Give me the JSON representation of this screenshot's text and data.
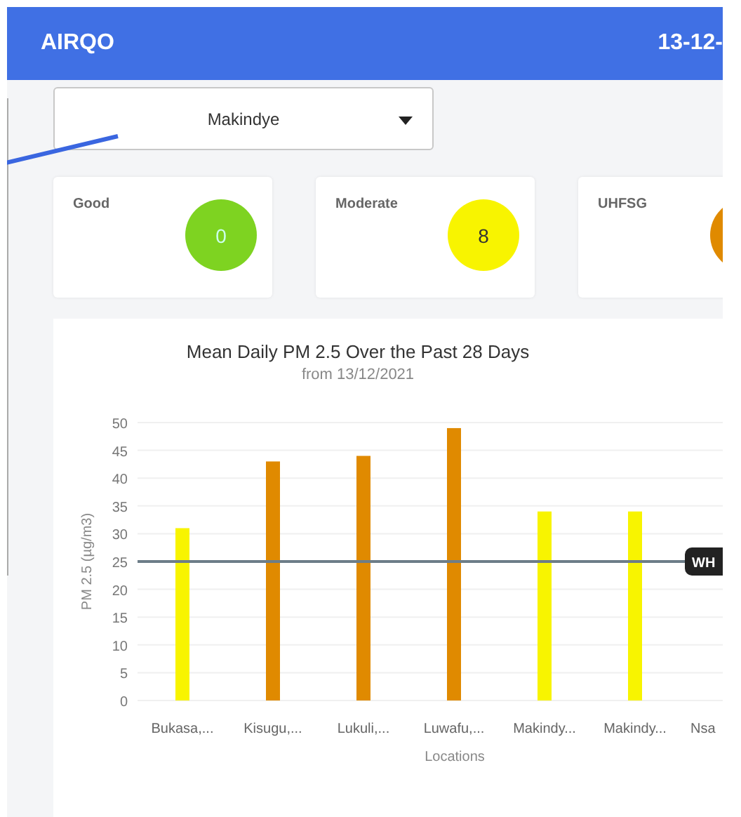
{
  "header": {
    "logo": "AIRQO",
    "date": "13-12-"
  },
  "location_select": {
    "value": "Makindye"
  },
  "category_cards": [
    {
      "label": "Good",
      "count": "0",
      "color": "#7ed321"
    },
    {
      "label": "Moderate",
      "count": "8",
      "color": "#f8f400"
    },
    {
      "label": "UHFSG",
      "color": "#e08a00"
    }
  ],
  "chart": {
    "title": "Mean Daily PM 2.5 Over the Past 28 Days",
    "subtitle": "from 13/12/2021",
    "chart_data": {
      "type": "bar",
      "xlabel": "Locations",
      "ylabel": "PM 2.5 (µg/m3)",
      "categories": [
        "Bukasa,...",
        "Kisugu,...",
        "Lukuli,...",
        "Luwafu,...",
        "Makindy...",
        "Makindy...",
        "Nsa"
      ],
      "series": [
        {
          "values": [
            31,
            43,
            44,
            49,
            34,
            34,
            null
          ]
        }
      ],
      "ylim": [
        0,
        50
      ],
      "yticks": [
        0,
        5,
        10,
        15,
        20,
        25,
        30,
        35,
        40,
        45,
        50
      ],
      "grid": true,
      "ref_lines": [
        {
          "axis": "y",
          "value": 25,
          "label": "WH"
        }
      ]
    }
  }
}
